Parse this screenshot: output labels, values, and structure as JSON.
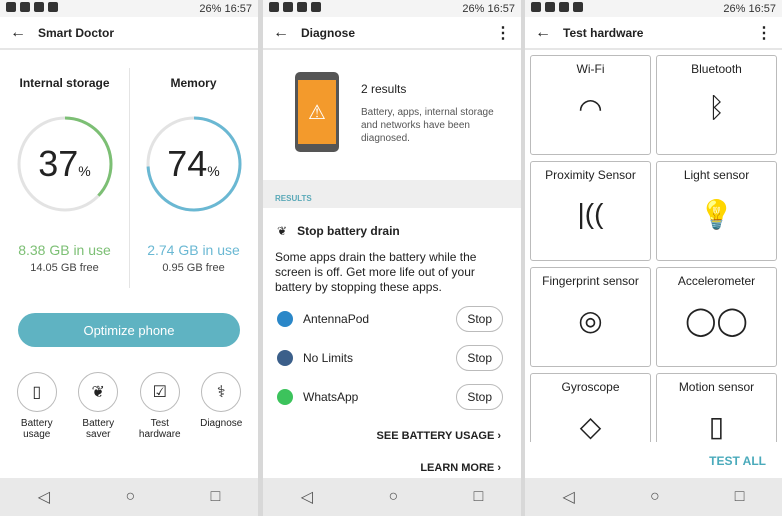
{
  "status": {
    "time": "16:57",
    "battery": "26%"
  },
  "p1": {
    "title": "Smart Doctor",
    "storage": {
      "label": "Internal storage",
      "percent": 37,
      "pct_sign": "%",
      "in_use": "8.38  GB in use",
      "free": "14.05  GB free",
      "color": "#7cbf74"
    },
    "memory": {
      "label": "Memory",
      "percent": 74,
      "pct_sign": "%",
      "in_use": "2.74  GB in use",
      "free": "0.95  GB free",
      "color": "#6ab8d3"
    },
    "optimize": "Optimize phone",
    "tools": [
      {
        "label": "Battery usage",
        "icon": "battery-icon",
        "g": "▯"
      },
      {
        "label": "Battery saver",
        "icon": "leaf-icon",
        "g": "❦"
      },
      {
        "label": "Test hardware",
        "icon": "phone-check-icon",
        "g": "☑"
      },
      {
        "label": "Diagnose",
        "icon": "stethoscope-icon",
        "g": "⚕"
      }
    ]
  },
  "p2": {
    "title": "Diagnose",
    "results": "2 results",
    "desc": "Battery, apps, internal storage and networks have been diagnosed.",
    "section": "RESULTS",
    "card_title": "Stop battery drain",
    "card_desc": "Some apps drain the battery while the screen is off. Get more life out of your battery by stopping these apps.",
    "apps": [
      {
        "name": "AntennaPod",
        "stop": "Stop",
        "color": "#2a87c8"
      },
      {
        "name": "No Limits",
        "stop": "Stop",
        "color": "#3b5f8a"
      },
      {
        "name": "WhatsApp",
        "stop": "Stop",
        "color": "#3cc35c"
      }
    ],
    "see_usage": "SEE BATTERY USAGE ›",
    "learn_more": "LEARN MORE ›"
  },
  "p3": {
    "title": "Test hardware",
    "test_all": "TEST ALL",
    "cards": [
      {
        "label": "Wi-Fi",
        "g": "◠"
      },
      {
        "label": "Bluetooth",
        "g": "ᛒ"
      },
      {
        "label": "Proximity Sensor",
        "g": "|(("
      },
      {
        "label": "Light sensor",
        "g": "💡"
      },
      {
        "label": "Fingerprint sensor",
        "g": "◎"
      },
      {
        "label": "Accelerometer",
        "g": "◯◯"
      },
      {
        "label": "Gyroscope",
        "g": "◇"
      },
      {
        "label": "Motion sensor",
        "g": "▯"
      }
    ]
  }
}
